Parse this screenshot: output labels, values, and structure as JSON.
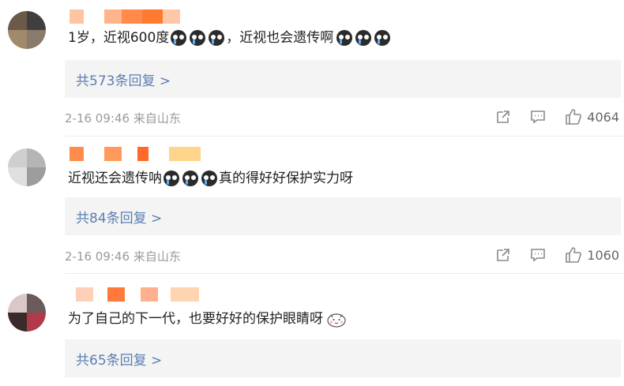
{
  "comments": [
    {
      "text_before": "1岁，近视600度",
      "text_after": "，近视也会遗传啊",
      "replies_label": "共573条回复 >",
      "date": "2-16 09:46",
      "location": "来自山东",
      "likes": "4064",
      "emoji_icon": "crying-face-icon"
    },
    {
      "text_before": "近视还会遗传呐",
      "text_after": "真的得好好保护实力呀",
      "replies_label": "共84条回复 >",
      "date": "2-16 09:46",
      "location": "来自山东",
      "likes": "1060",
      "emoji_icon": "crying-face-icon"
    },
    {
      "text_before": "为了自己的下一代，也要好好的保护眼睛呀",
      "replies_label": "共65条回复 >",
      "sticker_icon": "cute-face-sticker-icon"
    }
  ],
  "colors": {
    "reply_link": "#5a7fb3",
    "meta_text": "#9a9a9a",
    "reply_bg": "#f4f4f4"
  }
}
